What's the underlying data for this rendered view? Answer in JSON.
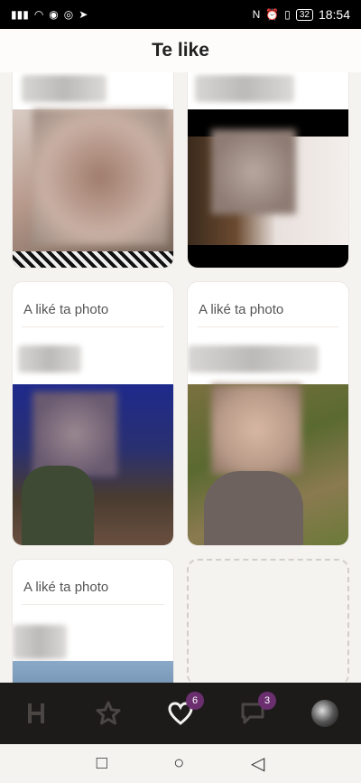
{
  "status": {
    "time": "18:54",
    "battery": "32",
    "left_icons": [
      "signal-icon",
      "wifi-icon",
      "eye-icon",
      "whatsapp-icon",
      "telegram-icon"
    ],
    "right_icons": [
      "nfc-icon",
      "alarm-icon",
      "vibrate-icon"
    ]
  },
  "header": {
    "title": "Te like"
  },
  "cards": [
    {
      "label": ""
    },
    {
      "label": ""
    },
    {
      "label": "A liké ta photo"
    },
    {
      "label": "A liké ta photo"
    },
    {
      "label": "A liké ta photo"
    }
  ],
  "nav": {
    "items": [
      {
        "icon": "home-h-icon"
      },
      {
        "icon": "star-icon"
      },
      {
        "icon": "heart-icon",
        "badge": "6",
        "active": true
      },
      {
        "icon": "chat-icon",
        "badge": "3"
      },
      {
        "icon": "avatar"
      }
    ]
  },
  "colors": {
    "accent": "#6b2f70",
    "nav_bg": "#1d1b1a",
    "background": "#f5f3f0"
  }
}
